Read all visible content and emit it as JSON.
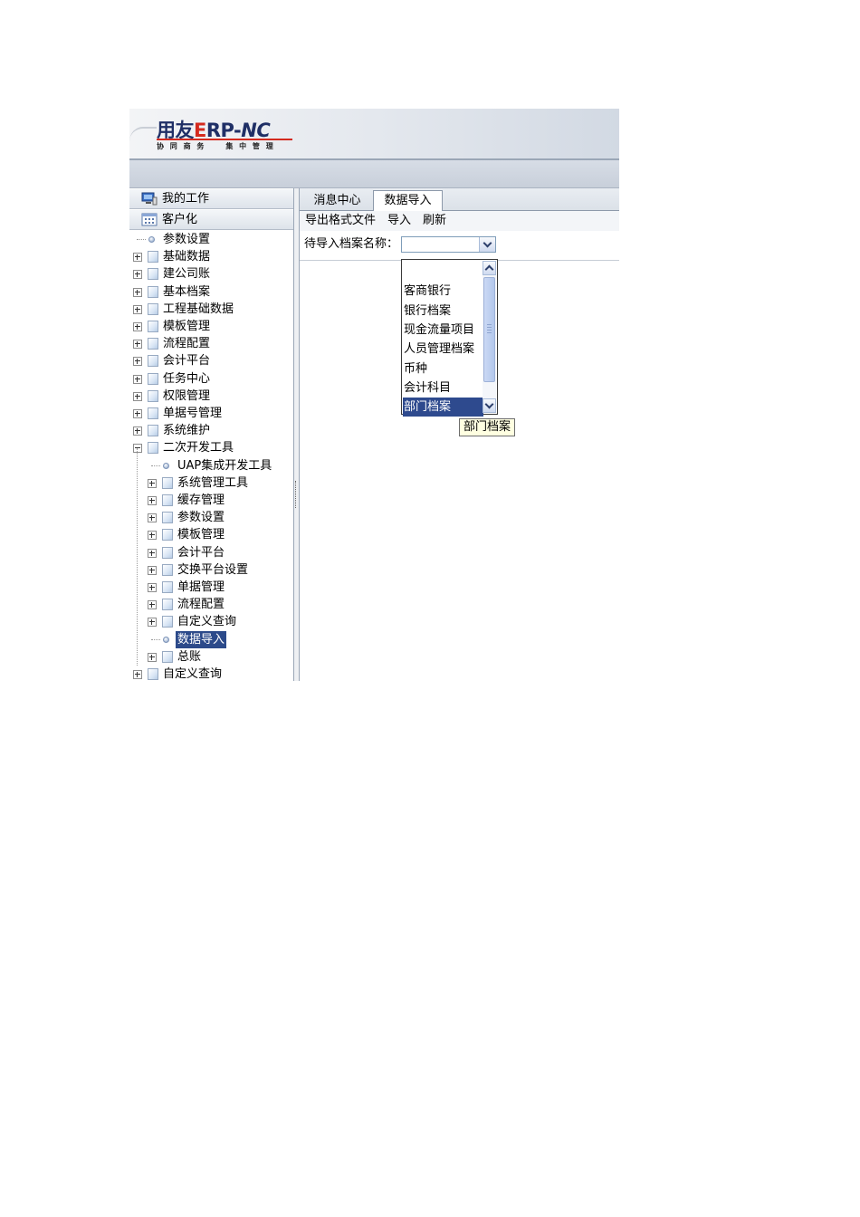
{
  "header": {
    "logo_main": "用友",
    "logo_e": "E",
    "logo_rp": "RP-",
    "logo_nc": "NC",
    "logo_sub_left": "协 同 商 务",
    "logo_sub_right": "集 中 管 理"
  },
  "sidebar": {
    "my_work": "我的工作",
    "customize": "客户化",
    "tree": [
      {
        "label": "参数设置",
        "level": 0,
        "type": "leaf"
      },
      {
        "label": "基础数据",
        "level": 0,
        "type": "folder"
      },
      {
        "label": "建公司账",
        "level": 0,
        "type": "folder"
      },
      {
        "label": "基本档案",
        "level": 0,
        "type": "folder"
      },
      {
        "label": "工程基础数据",
        "level": 0,
        "type": "folder"
      },
      {
        "label": "模板管理",
        "level": 0,
        "type": "folder"
      },
      {
        "label": "流程配置",
        "level": 0,
        "type": "folder"
      },
      {
        "label": "会计平台",
        "level": 0,
        "type": "folder"
      },
      {
        "label": "任务中心",
        "level": 0,
        "type": "folder"
      },
      {
        "label": "权限管理",
        "level": 0,
        "type": "folder"
      },
      {
        "label": "单据号管理",
        "level": 0,
        "type": "folder"
      },
      {
        "label": "系统维护",
        "level": 0,
        "type": "folder"
      },
      {
        "label": "二次开发工具",
        "level": 0,
        "type": "folder",
        "expanded": true
      },
      {
        "label": "UAP集成开发工具",
        "level": 1,
        "type": "leaf"
      },
      {
        "label": "系统管理工具",
        "level": 1,
        "type": "folder"
      },
      {
        "label": "缓存管理",
        "level": 1,
        "type": "folder"
      },
      {
        "label": "参数设置",
        "level": 1,
        "type": "folder"
      },
      {
        "label": "模板管理",
        "level": 1,
        "type": "folder"
      },
      {
        "label": "会计平台",
        "level": 1,
        "type": "folder"
      },
      {
        "label": "交换平台设置",
        "level": 1,
        "type": "folder"
      },
      {
        "label": "单据管理",
        "level": 1,
        "type": "folder"
      },
      {
        "label": "流程配置",
        "level": 1,
        "type": "folder"
      },
      {
        "label": "自定义查询",
        "level": 1,
        "type": "folder"
      },
      {
        "label": "数据导入",
        "level": 1,
        "type": "leaf",
        "selected": true
      },
      {
        "label": "总账",
        "level": 1,
        "type": "folder"
      },
      {
        "label": "自定义查询",
        "level": 0,
        "type": "folder"
      }
    ]
  },
  "main": {
    "tabs": [
      {
        "label": "消息中心",
        "active": false
      },
      {
        "label": "数据导入",
        "active": true
      }
    ],
    "toolbar": {
      "export_format": "导出格式文件",
      "import": "导入",
      "refresh": "刷新"
    },
    "form": {
      "label": "待导入档案名称：",
      "combo_value": ""
    },
    "dropdown_options": [
      {
        "label": "",
        "selected": false
      },
      {
        "label": "客商银行",
        "selected": false
      },
      {
        "label": "银行档案",
        "selected": false
      },
      {
        "label": "现金流量项目",
        "selected": false
      },
      {
        "label": "人员管理档案",
        "selected": false
      },
      {
        "label": "币种",
        "selected": false
      },
      {
        "label": "会计科目",
        "selected": false
      },
      {
        "label": "部门档案",
        "selected": true
      }
    ],
    "tooltip": "部门档案"
  },
  "colors": {
    "selection": "#2e4a8e",
    "logo_red": "#d42a1e",
    "logo_blue": "#1f2f66",
    "tooltip_bg": "#ffffe1"
  }
}
